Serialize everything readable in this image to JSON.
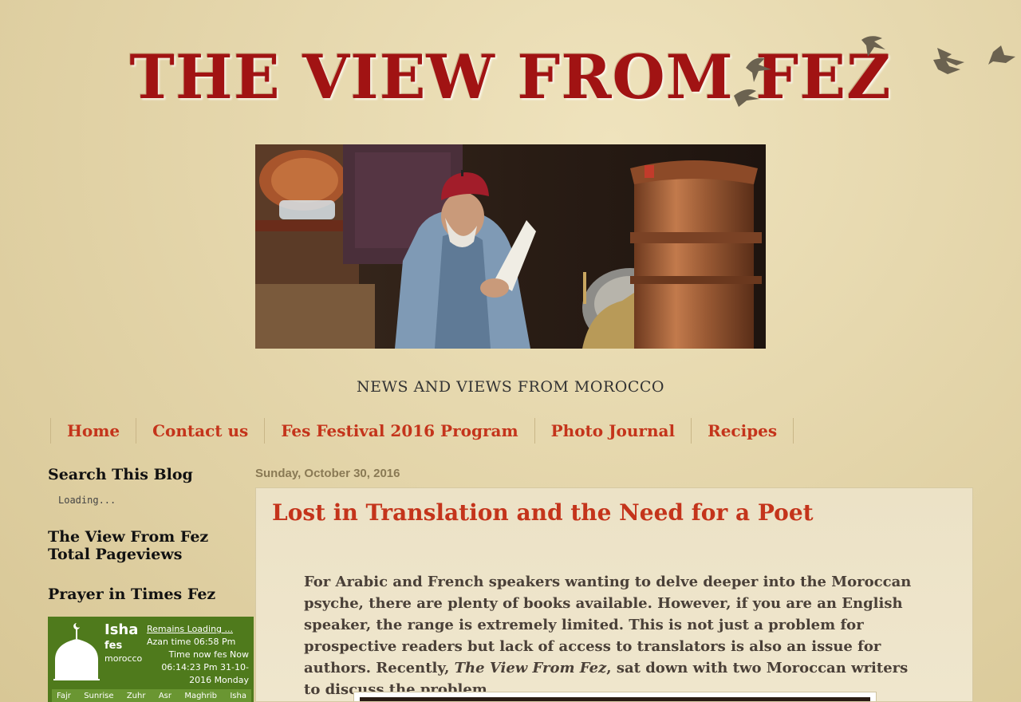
{
  "header": {
    "site_title": "THE VIEW FROM FEZ",
    "tagline": "NEWS AND VIEWS FROM MOROCCO"
  },
  "nav": {
    "items": [
      "Home",
      "Contact us",
      "Fes Festival 2016 Program",
      "Photo Journal",
      "Recipes"
    ]
  },
  "sidebar": {
    "search_title": "Search This Blog",
    "search_loading": "Loading...",
    "pageviews_title_line1": "The View From Fez",
    "pageviews_title_line2": "Total Pageviews",
    "prayer_title": "Prayer in Times Fez",
    "prayer_widget": {
      "prayer_name": "Isha",
      "city": "fes",
      "country": "morocco",
      "remains": "Remains Loading ...",
      "azan_time": "Azan time 06:58 Pm",
      "time_now_line1": "Time now fes Now",
      "time_now_line2": "06:14:23 Pm 31-10-",
      "time_now_line3": "2016 Monday",
      "prayers": [
        "Fajr",
        "Sunrise",
        "Zuhr",
        "Asr",
        "Maghrib",
        "Isha"
      ]
    }
  },
  "post": {
    "date": "Sunday, October 30, 2016",
    "title": "Lost in Translation and the Need for a Poet",
    "body_part1": "For Arabic and French speakers wanting to delve deeper into the Moroccan psyche, there are plenty of books available. However, if you are an English speaker, the range is extremely limited. This is not just a problem for prospective readers but lack of access to translators is also an issue for authors. Recently, ",
    "body_em": "The View From Fez",
    "body_part2": ", sat down with two Moroccan writers to discuss the problem"
  },
  "colors": {
    "title_red": "#a11313",
    "link_red": "#c4341b",
    "background": "#e4d6ac",
    "widget_green": "#4f7a1c"
  }
}
